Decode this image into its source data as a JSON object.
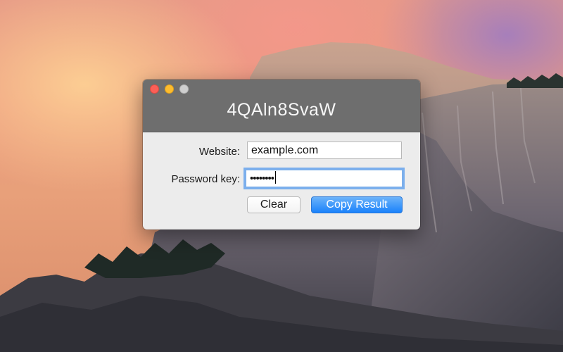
{
  "window": {
    "title": "4QAln8SvaW",
    "traffic_lights": {
      "close_color": "#fc5f57",
      "minimize_color": "#fdbc2e",
      "zoom_color": "#cfcfcf"
    }
  },
  "form": {
    "website_label": "Website:",
    "website_value": "example.com",
    "password_label": "Password key:",
    "password_value": "••••••••"
  },
  "buttons": {
    "clear_label": "Clear",
    "copy_label": "Copy Result"
  },
  "colors": {
    "titlebar": "#6e6e6e",
    "accent": "#1a82fb",
    "focus_ring": "#569bee"
  }
}
